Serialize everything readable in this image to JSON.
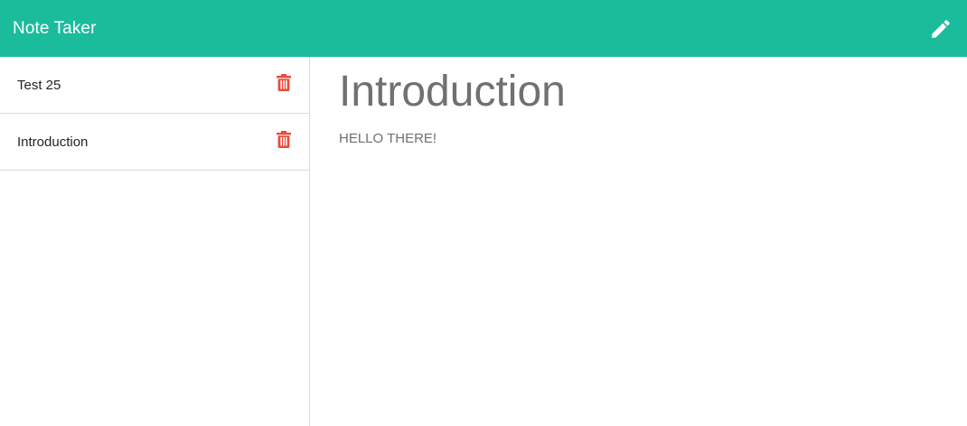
{
  "navbar": {
    "brand": "Note Taker",
    "new_note_icon": "pencil-icon",
    "background_color": "#1abc9c"
  },
  "sidebar": {
    "notes": [
      {
        "title": "Test 25",
        "delete_icon": "trash-icon"
      },
      {
        "title": "Introduction",
        "delete_icon": "trash-icon"
      }
    ],
    "delete_icon_color": "#e74c3c"
  },
  "main": {
    "note_title": "Introduction",
    "note_text": "HELLO THERE!"
  }
}
